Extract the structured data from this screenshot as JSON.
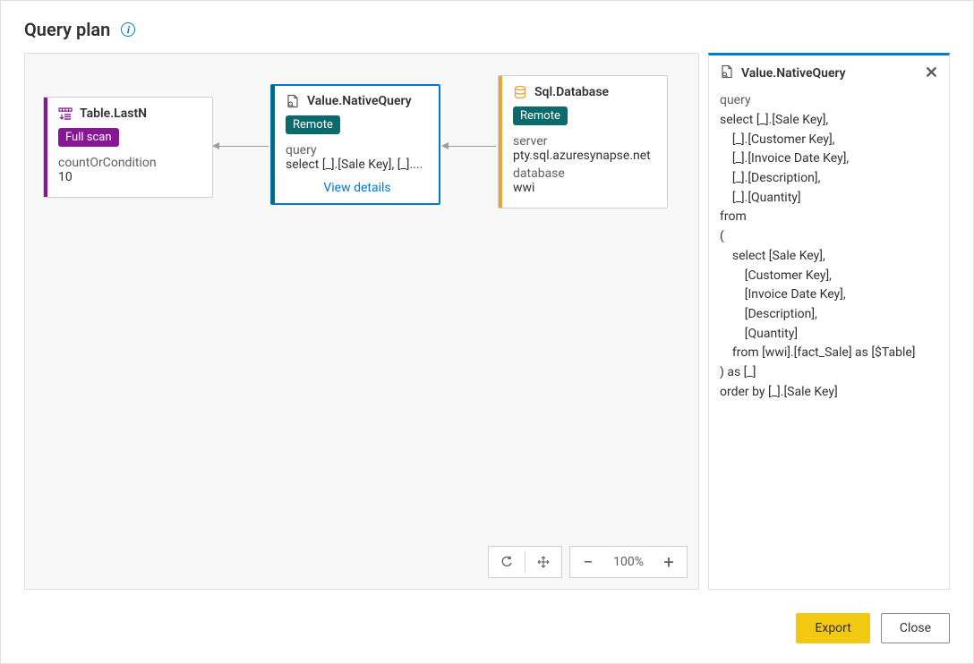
{
  "header": {
    "title": "Query plan"
  },
  "nodes": {
    "lastn": {
      "title": "Table.LastN",
      "badge": "Full scan",
      "param_label": "countOrCondition",
      "param_value": "10"
    },
    "native": {
      "title": "Value.NativeQuery",
      "badge": "Remote",
      "query_label": "query",
      "query_value": "select [_].[Sale Key], [_]....",
      "view_details": "View details"
    },
    "sqldb": {
      "title": "Sql.Database",
      "badge": "Remote",
      "server_label": "server",
      "server_value": "pty.sql.azuresynapse.net",
      "database_label": "database",
      "database_value": "wwi"
    }
  },
  "details": {
    "title": "Value.NativeQuery",
    "label": "query",
    "body": "select [_].[Sale Key],\n    [_].[Customer Key],\n    [_].[Invoice Date Key],\n    [_].[Description],\n    [_].[Quantity]\nfrom \n(\n    select [Sale Key],\n        [Customer Key],\n        [Invoice Date Key],\n        [Description],\n        [Quantity]\n    from [wwi].[fact_Sale] as [$Table]\n) as [_]\norder by [_].[Sale Key]"
  },
  "zoom": {
    "percent": "100%"
  },
  "footer": {
    "export": "Export",
    "close": "Close"
  },
  "colors": {
    "purple": "#881798",
    "teal": "#0b6a6c",
    "orange": "#e8a33d",
    "blue": "#0078d4",
    "yellow": "#f2c811"
  }
}
